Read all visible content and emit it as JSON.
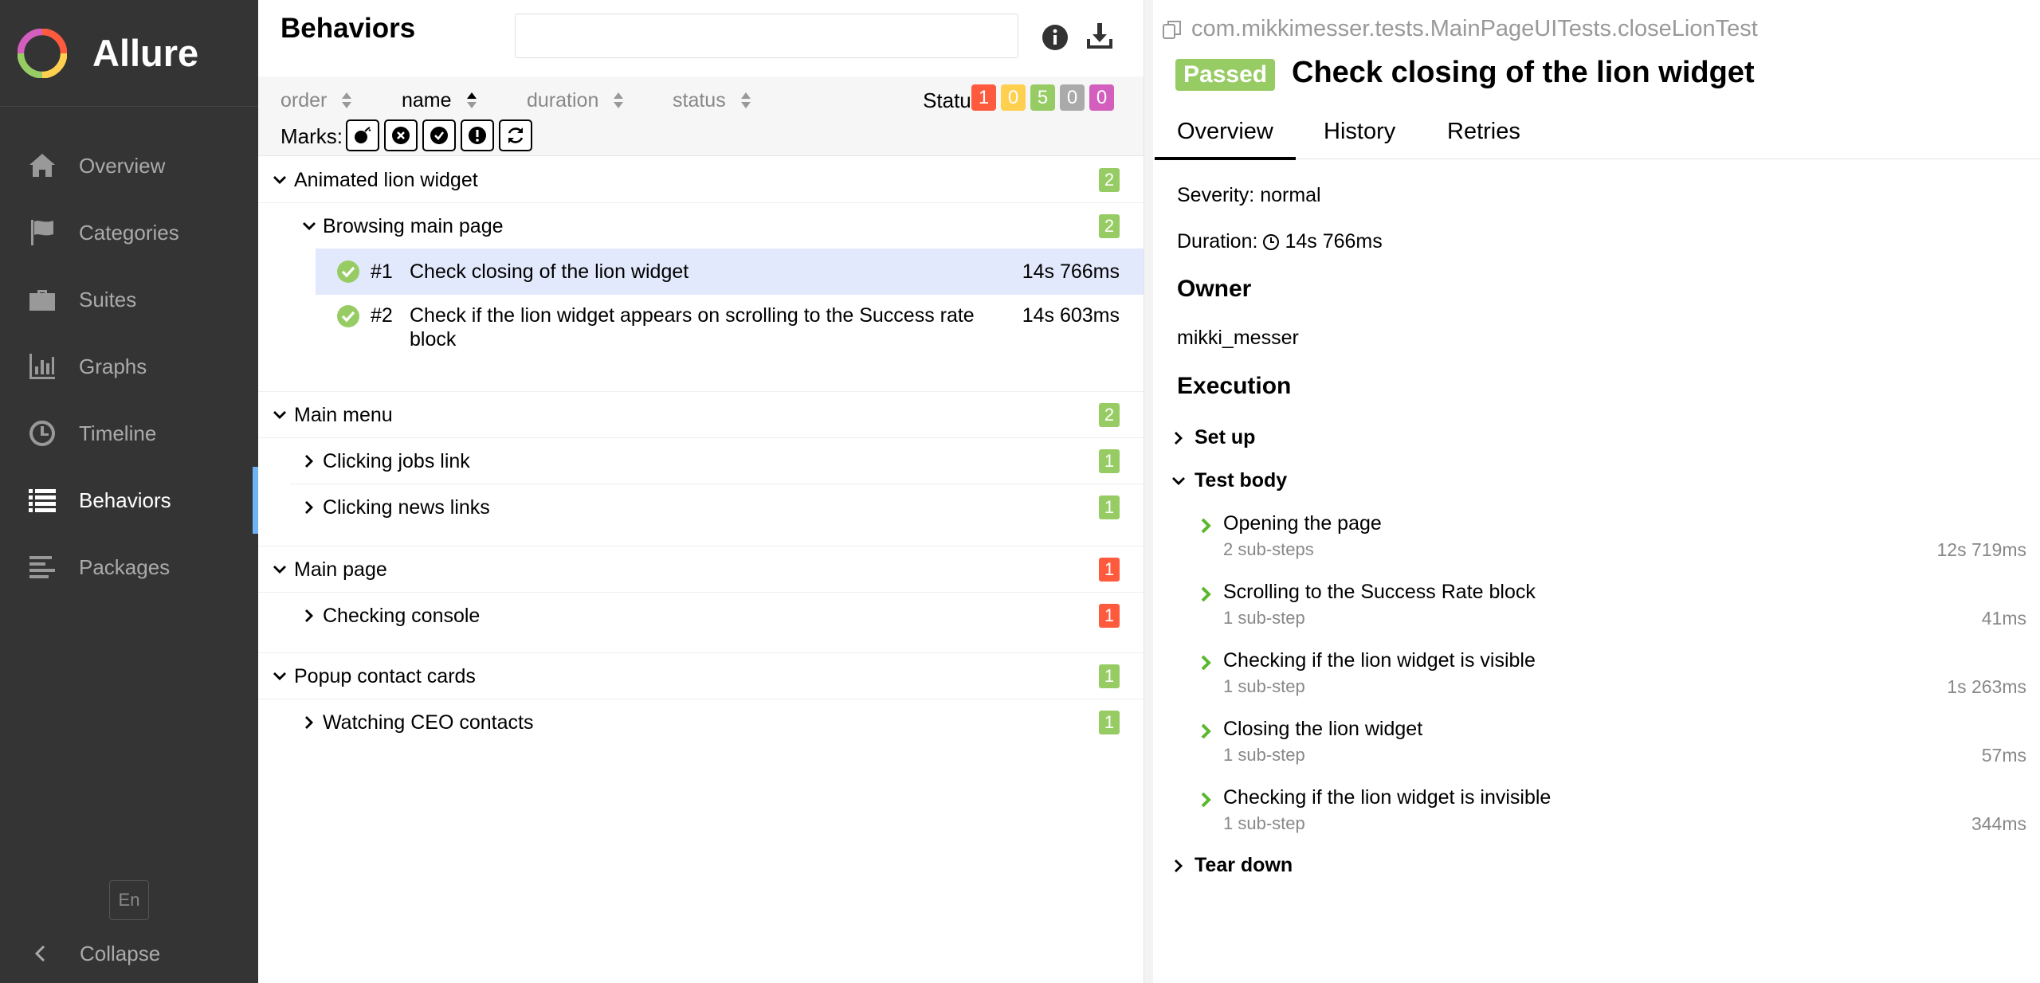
{
  "sidebar": {
    "brand": "Allure",
    "items": [
      {
        "label": "Overview",
        "icon": "home-icon"
      },
      {
        "label": "Categories",
        "icon": "flag-icon"
      },
      {
        "label": "Suites",
        "icon": "briefcase-icon"
      },
      {
        "label": "Graphs",
        "icon": "bar-chart-icon"
      },
      {
        "label": "Timeline",
        "icon": "clock-icon"
      },
      {
        "label": "Behaviors",
        "icon": "list-icon",
        "active": true
      },
      {
        "label": "Packages",
        "icon": "align-left-icon"
      }
    ],
    "language": "En",
    "collapse": "Collapse"
  },
  "behaviors": {
    "title": "Behaviors",
    "search_placeholder": "",
    "sort": {
      "order": "order",
      "name": "name",
      "duration": "duration",
      "status": "status"
    },
    "status_label": "Status:",
    "status_counts": {
      "failed": "1",
      "broken": "0",
      "passed": "5",
      "skipped": "0",
      "unknown": "0"
    },
    "marks_label": "Marks:",
    "tree": {
      "g1": {
        "name": "Animated lion widget",
        "count": "2"
      },
      "g1s1": {
        "name": "Browsing main page",
        "count": "2"
      },
      "t1": {
        "num": "#1",
        "name": "Check closing of the lion widget",
        "duration": "14s 766ms"
      },
      "t2": {
        "num": "#2",
        "name": "Check if the lion widget appears on scrolling to the Success rate block",
        "duration": "14s 603ms"
      },
      "g2": {
        "name": "Main menu",
        "count": "2"
      },
      "g2s1": {
        "name": "Clicking jobs link",
        "count": "1"
      },
      "g2s2": {
        "name": "Clicking news links",
        "count": "1"
      },
      "g3": {
        "name": "Main page",
        "count": "1"
      },
      "g3s1": {
        "name": "Checking console",
        "count": "1"
      },
      "g4": {
        "name": "Popup contact cards",
        "count": "1"
      },
      "g4s1": {
        "name": "Watching CEO contacts",
        "count": "1"
      }
    }
  },
  "testcase": {
    "full_name": "com.mikkimesser.tests.MainPageUITests.closeLionTest",
    "status": "Passed",
    "title": "Check closing of the lion widget",
    "tabs": {
      "overview": "Overview",
      "history": "History",
      "retries": "Retries"
    },
    "severity": "Severity: normal",
    "duration_label": "Duration:",
    "duration": "14s 766ms",
    "owner_heading": "Owner",
    "owner": "mikki_messer",
    "execution_heading": "Execution",
    "setup": "Set up",
    "body": "Test body",
    "teardown": "Tear down",
    "steps": [
      {
        "name": "Opening the page",
        "sub": "2 sub-steps",
        "duration": "12s 719ms"
      },
      {
        "name": "Scrolling to the Success Rate block",
        "sub": "1 sub-step",
        "duration": "41ms"
      },
      {
        "name": "Checking if the lion widget is visible",
        "sub": "1 sub-step",
        "duration": "1s 263ms"
      },
      {
        "name": "Closing the lion widget",
        "sub": "1 sub-step",
        "duration": "57ms"
      },
      {
        "name": "Checking if the lion widget is invisible",
        "sub": "1 sub-step",
        "duration": "344ms"
      }
    ]
  },
  "colors": {
    "failed": "#fd5a3e",
    "broken": "#ffd050",
    "passed": "#97cc64",
    "skipped": "#aaaaaa",
    "unknown": "#d35ebe",
    "sidebar": "#343434",
    "selected_row": "#e3e9fc",
    "active_marker": "#6eb4f5"
  }
}
